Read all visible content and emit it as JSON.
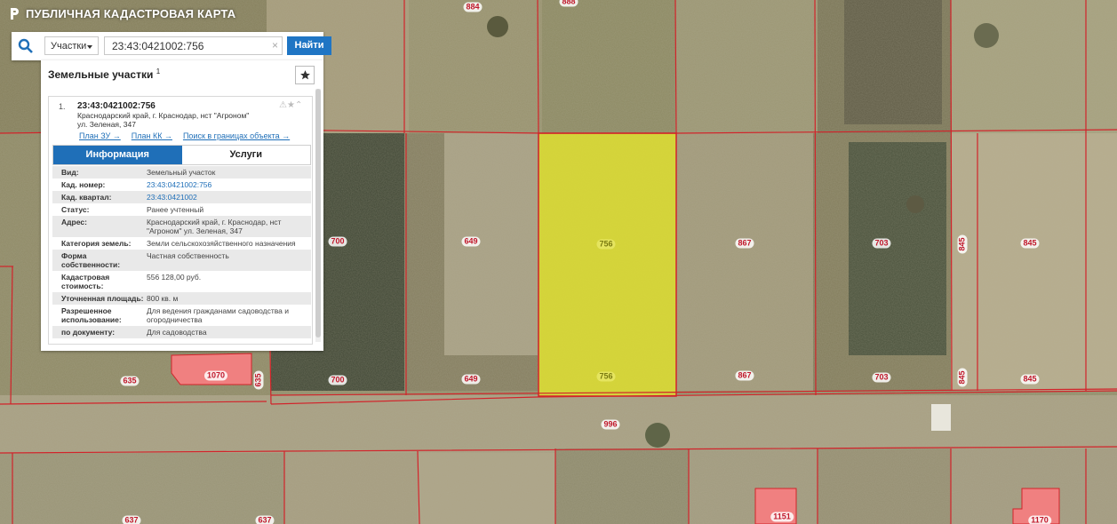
{
  "app": {
    "title": "ПУБЛИЧНАЯ КАДАСТРОВАЯ КАРТА"
  },
  "search": {
    "type_label": "Участки",
    "query": "23:43:0421002:756",
    "clear_label": "×",
    "find_label": "Найти"
  },
  "panel": {
    "title": "Земельные участки",
    "count": "1",
    "result": {
      "index": "1.",
      "cadastral_number": "23:43:0421002:756",
      "address_line1": "Краснодарский край, г. Краснодар, нст \"Агроном\"",
      "address_line2": "ул. Зеленая, 347",
      "links": [
        "План ЗУ →",
        "План КК →",
        "Поиск в границах объекта →"
      ],
      "tabs": [
        "Информация",
        "Услуги"
      ],
      "properties": [
        {
          "key": "Вид:",
          "value": "Земельный участок"
        },
        {
          "key": "Кад. номер:",
          "value": "23:43:0421002:756",
          "link": true
        },
        {
          "key": "Кад. квартал:",
          "value": "23:43:0421002",
          "link": true
        },
        {
          "key": "Статус:",
          "value": "Ранее учтенный"
        },
        {
          "key": "Адрес:",
          "value": "Краснодарский край, г. Краснодар, нст \"Агроном\" ул. Зеленая, 347"
        },
        {
          "key": "Категория земель:",
          "value": "Земли сельскохозяйственного назначения"
        },
        {
          "key": "Форма собственности:",
          "value": "Частная собственность"
        },
        {
          "key": "Кадастровая стоимость:",
          "value": "556 128,00 руб."
        },
        {
          "key": "Уточненная площадь:",
          "value": "800 кв. м"
        },
        {
          "key": "Разрешенное использование:",
          "value": "Для ведения гражданами садоводства и огородничества"
        },
        {
          "key": "по документу:",
          "value": "Для садоводства"
        }
      ]
    }
  },
  "map": {
    "selected_color": "#e6e62a",
    "boundary_color": "#d2232a",
    "labels": [
      "884",
      "888",
      "700",
      "649",
      "756",
      "867",
      "703",
      "845",
      "845",
      "635",
      "1070",
      "635",
      "700",
      "649",
      "756",
      "867",
      "703",
      "845",
      "845",
      "996",
      "637",
      "637",
      "1151",
      "1170"
    ]
  }
}
